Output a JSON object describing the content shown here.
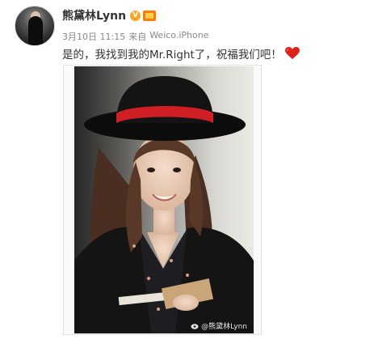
{
  "user": {
    "name": "熊黛林Lynn",
    "vip_glyph": "V"
  },
  "post": {
    "date": "3月10日 11:15",
    "source_prefix": "来自",
    "source": "Weico.iPhone",
    "text": "是的，我找到我的Mr.Right了，祝福我们吧！"
  },
  "photo": {
    "watermark": "@熊黛林Lynn"
  },
  "colors": {
    "name": "#333333",
    "meta": "#888888",
    "vip_badge": "#f6a623",
    "heart": "#e0201b"
  }
}
